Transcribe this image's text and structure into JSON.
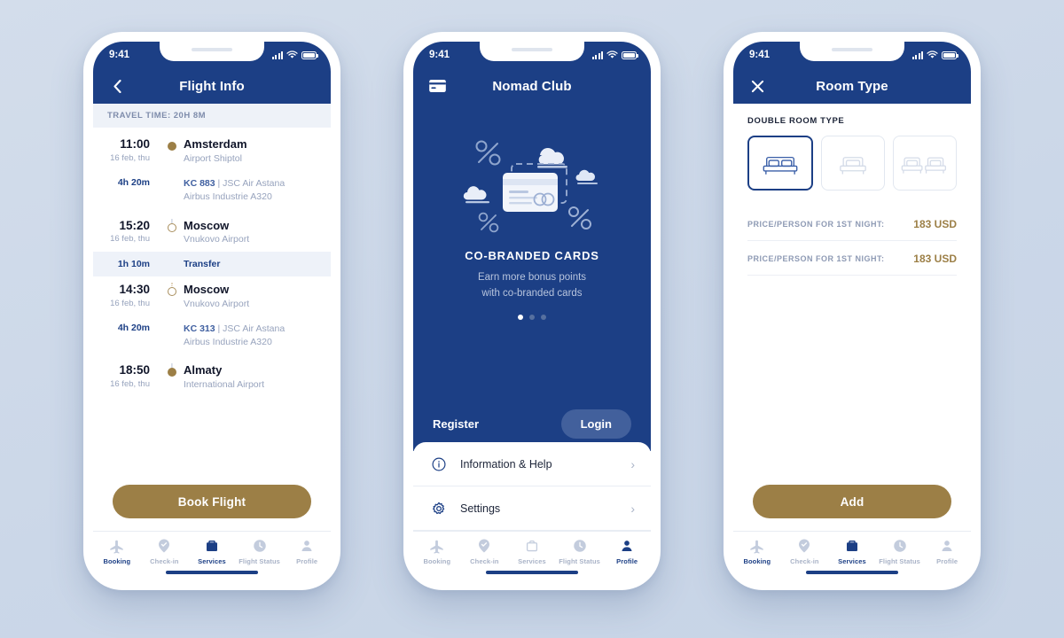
{
  "theme": {
    "navy": "#1c3f85",
    "gold": "#9c7f46",
    "page_bg": "#ccd8e8",
    "muted": "#97a3bd"
  },
  "phone1": {
    "status": {
      "time": "9:41",
      "signal_icon": "cellular-bars-icon",
      "wifi_icon": "wifi-icon",
      "battery_icon": "battery-full-icon"
    },
    "nav": {
      "back_icon": "chevron-left-icon",
      "title": "Flight Info"
    },
    "travel_time": "TRAVEL TIME: 20H 8M",
    "itinerary": [
      {
        "kind": "stop",
        "marker": "filled",
        "time": "11:00",
        "date": "16 feb, thu",
        "city": "Amsterdam",
        "airport": "Airport Shiptol"
      },
      {
        "kind": "leg",
        "marker": "line",
        "duration": "4h 20m",
        "flight_code": "KC 883",
        "separator": " | ",
        "airline": "JSC Air Astana",
        "aircraft": "Airbus Industrie A320"
      },
      {
        "kind": "stop",
        "marker": "hollow",
        "time": "15:20",
        "date": "16 feb, thu",
        "city": "Moscow",
        "airport": "Vnukovo Airport"
      },
      {
        "kind": "transfer",
        "marker": "dotted",
        "duration": "1h 10m",
        "label": "Transfer"
      },
      {
        "kind": "stop",
        "marker": "hollow",
        "time": "14:30",
        "date": "16 feb, thu",
        "city": "Moscow",
        "airport": "Vnukovo Airport"
      },
      {
        "kind": "leg",
        "marker": "line",
        "duration": "4h 20m",
        "flight_code": "KC 313",
        "separator": " | ",
        "airline": "JSC Air Astana",
        "aircraft": "Airbus Industrie A320"
      },
      {
        "kind": "stop",
        "marker": "filled",
        "time": "18:50",
        "date": "16 feb, thu",
        "city": "Almaty",
        "airport": "International Airport"
      }
    ],
    "cta": "Book Flight",
    "tabs": [
      {
        "label": "Booking",
        "icon": "airplane-icon",
        "state": "blue-label"
      },
      {
        "label": "Check-in",
        "icon": "check-pin-icon",
        "state": "inactive"
      },
      {
        "label": "Services",
        "icon": "suitcase-icon",
        "state": "active"
      },
      {
        "label": "Flight Status",
        "icon": "clock-icon",
        "state": "inactive"
      },
      {
        "label": "Profile",
        "icon": "person-icon",
        "state": "inactive"
      }
    ]
  },
  "phone2": {
    "status": {
      "time": "9:41"
    },
    "nav": {
      "left_icon": "credit-card-icon",
      "title": "Nomad Club"
    },
    "illustration": "credit-cards-clouds-percent-illustration",
    "promo": {
      "title": "CO-BRANDED CARDS",
      "subtitle_line1": "Earn more bonus points",
      "subtitle_line2": "with  co-branded cards",
      "dots_total": 3,
      "dots_active_index": 0
    },
    "register_label": "Register",
    "login_label": "Login",
    "menu": [
      {
        "label": "Information & Help",
        "icon": "info-circle-icon",
        "chevron": "chevron-right-icon"
      },
      {
        "label": "Settings",
        "icon": "gear-icon",
        "chevron": "chevron-right-icon"
      }
    ],
    "tabs": [
      {
        "label": "Booking",
        "icon": "airplane-icon",
        "state": "inactive"
      },
      {
        "label": "Check-in",
        "icon": "check-pin-icon",
        "state": "inactive"
      },
      {
        "label": "Services",
        "icon": "suitcase-icon",
        "state": "inactive"
      },
      {
        "label": "Flight Status",
        "icon": "clock-icon",
        "state": "inactive"
      },
      {
        "label": "Profile",
        "icon": "person-icon",
        "state": "active"
      }
    ]
  },
  "phone3": {
    "status": {
      "time": "9:41"
    },
    "nav": {
      "close_icon": "close-x-icon",
      "title": "Room Type"
    },
    "section_label": "DOUBLE ROOM TYPE",
    "bed_options": [
      {
        "icon": "double-bed-icon",
        "selected": true
      },
      {
        "icon": "single-bed-icon",
        "selected": false
      },
      {
        "icon": "twin-beds-icon",
        "selected": false
      }
    ],
    "prices": [
      {
        "label": "PRICE/PERSON FOR 1ST NIGHT:",
        "value": "183 USD"
      },
      {
        "label": "PRICE/PERSON FOR 1ST NIGHT:",
        "value": "183 USD"
      }
    ],
    "cta": "Add",
    "tabs": [
      {
        "label": "Booking",
        "icon": "airplane-icon",
        "state": "blue-label"
      },
      {
        "label": "Check-in",
        "icon": "check-pin-icon",
        "state": "inactive"
      },
      {
        "label": "Services",
        "icon": "suitcase-icon",
        "state": "active"
      },
      {
        "label": "Flight Status",
        "icon": "clock-icon",
        "state": "inactive"
      },
      {
        "label": "Profile",
        "icon": "person-icon",
        "state": "inactive"
      }
    ]
  }
}
